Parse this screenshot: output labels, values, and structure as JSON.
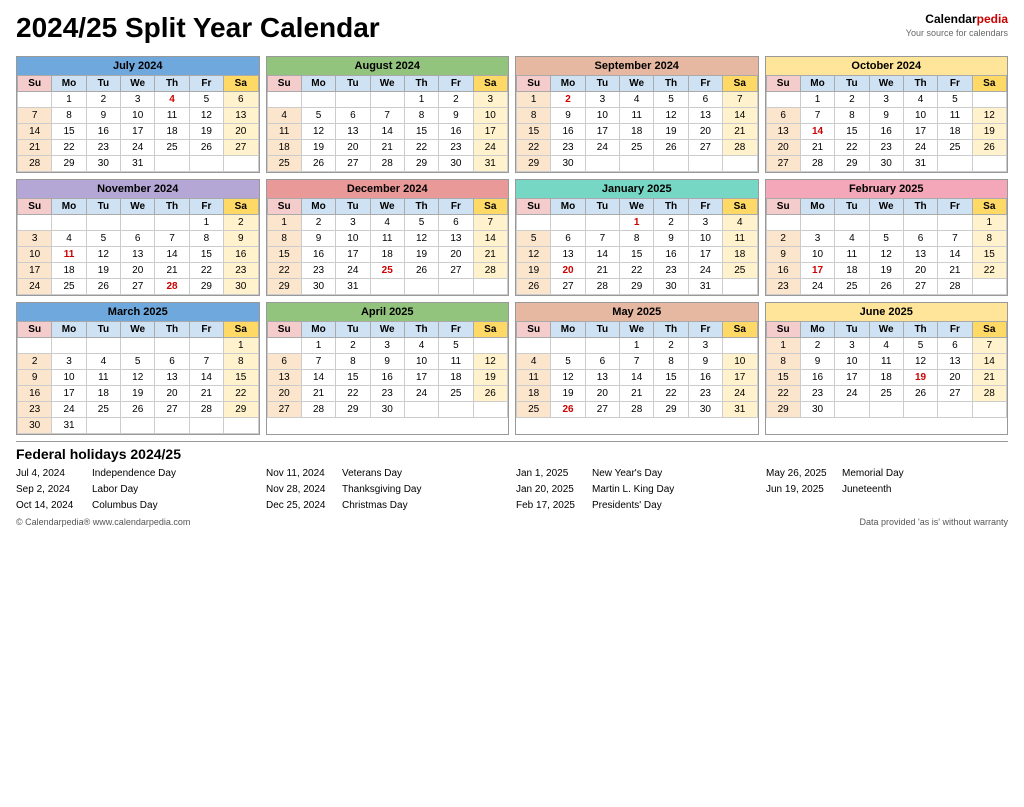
{
  "title": "2024/25 Split Year Calendar",
  "logo": {
    "calendar": "Calendar",
    "pedia": "pedia",
    "tagline": "Your source for calendars"
  },
  "months": [
    {
      "name": "July 2024",
      "headerClass": "blue",
      "days": [
        [
          "",
          "1",
          "2",
          "3",
          "4",
          "5",
          "6"
        ],
        [
          "7",
          "8",
          "9",
          "10",
          "11",
          "12",
          "13"
        ],
        [
          "14",
          "15",
          "16",
          "17",
          "18",
          "19",
          "20"
        ],
        [
          "21",
          "22",
          "23",
          "24",
          "25",
          "26",
          "27"
        ],
        [
          "28",
          "29",
          "30",
          "31",
          "",
          "",
          ""
        ]
      ],
      "holidays": [
        4
      ],
      "holidayType": "red"
    },
    {
      "name": "August 2024",
      "headerClass": "green",
      "days": [
        [
          "",
          "",
          "",
          "",
          "1",
          "2",
          "3"
        ],
        [
          "4",
          "5",
          "6",
          "7",
          "8",
          "9",
          "10"
        ],
        [
          "11",
          "12",
          "13",
          "14",
          "15",
          "16",
          "17"
        ],
        [
          "18",
          "19",
          "20",
          "21",
          "22",
          "23",
          "24"
        ],
        [
          "25",
          "26",
          "27",
          "28",
          "29",
          "30",
          "31"
        ]
      ],
      "holidays": [],
      "holidayType": ""
    },
    {
      "name": "September 2024",
      "headerClass": "orange",
      "days": [
        [
          "1",
          "2",
          "3",
          "4",
          "5",
          "6",
          "7"
        ],
        [
          "8",
          "9",
          "10",
          "11",
          "12",
          "13",
          "14"
        ],
        [
          "15",
          "16",
          "17",
          "18",
          "19",
          "20",
          "21"
        ],
        [
          "22",
          "23",
          "24",
          "25",
          "26",
          "27",
          "28"
        ],
        [
          "29",
          "30",
          "",
          "",
          "",
          "",
          ""
        ]
      ],
      "holidays": [
        2
      ],
      "holidayType": "red"
    },
    {
      "name": "October 2024",
      "headerClass": "yellow",
      "days": [
        [
          "",
          "1",
          "2",
          "3",
          "4",
          "5",
          ""
        ],
        [
          "6",
          "7",
          "8",
          "9",
          "10",
          "11",
          "12"
        ],
        [
          "13",
          "14",
          "15",
          "16",
          "17",
          "18",
          "19"
        ],
        [
          "20",
          "21",
          "22",
          "23",
          "24",
          "25",
          "26"
        ],
        [
          "27",
          "28",
          "29",
          "30",
          "31",
          "",
          ""
        ]
      ],
      "holidays": [
        14
      ],
      "holidayType": "red",
      "satBg": true
    },
    {
      "name": "November 2024",
      "headerClass": "purple",
      "days": [
        [
          "",
          "",
          "",
          "",
          "",
          "1",
          "2"
        ],
        [
          "3",
          "4",
          "5",
          "6",
          "7",
          "8",
          "9"
        ],
        [
          "10",
          "11",
          "12",
          "13",
          "14",
          "15",
          "16"
        ],
        [
          "17",
          "18",
          "19",
          "20",
          "21",
          "22",
          "23"
        ],
        [
          "24",
          "25",
          "26",
          "27",
          "28",
          "29",
          "30"
        ]
      ],
      "holidays": [
        11,
        28
      ],
      "holidayType": "red"
    },
    {
      "name": "December 2024",
      "headerClass": "red-h",
      "days": [
        [
          "1",
          "2",
          "3",
          "4",
          "5",
          "6",
          "7"
        ],
        [
          "8",
          "9",
          "10",
          "11",
          "12",
          "13",
          "14"
        ],
        [
          "15",
          "16",
          "17",
          "18",
          "19",
          "20",
          "21"
        ],
        [
          "22",
          "23",
          "24",
          "25",
          "26",
          "27",
          "28"
        ],
        [
          "29",
          "30",
          "31",
          "",
          "",
          "",
          ""
        ]
      ],
      "holidays": [
        25
      ],
      "holidayType": "red"
    },
    {
      "name": "January 2025",
      "headerClass": "teal",
      "days": [
        [
          "",
          "",
          "",
          "1",
          "2",
          "3",
          "4"
        ],
        [
          "5",
          "6",
          "7",
          "8",
          "9",
          "10",
          "11"
        ],
        [
          "12",
          "13",
          "14",
          "15",
          "16",
          "17",
          "18"
        ],
        [
          "19",
          "20",
          "21",
          "22",
          "23",
          "24",
          "25"
        ],
        [
          "26",
          "27",
          "28",
          "29",
          "30",
          "31",
          ""
        ]
      ],
      "holidays": [
        1,
        20
      ],
      "holidayType": "red"
    },
    {
      "name": "February 2025",
      "headerClass": "pink",
      "days": [
        [
          "",
          "",
          "",
          "",
          "",
          "",
          "1"
        ],
        [
          "2",
          "3",
          "4",
          "5",
          "6",
          "7",
          "8"
        ],
        [
          "9",
          "10",
          "11",
          "12",
          "13",
          "14",
          "15"
        ],
        [
          "16",
          "17",
          "18",
          "19",
          "20",
          "21",
          "22"
        ],
        [
          "23",
          "24",
          "25",
          "26",
          "27",
          "28",
          ""
        ]
      ],
      "holidays": [
        17
      ],
      "holidayType": "red"
    },
    {
      "name": "March 2025",
      "headerClass": "blue",
      "days": [
        [
          "",
          "",
          "",
          "",
          "",
          "",
          "1"
        ],
        [
          "2",
          "3",
          "4",
          "5",
          "6",
          "7",
          "8"
        ],
        [
          "9",
          "10",
          "11",
          "12",
          "13",
          "14",
          "15"
        ],
        [
          "16",
          "17",
          "18",
          "19",
          "20",
          "21",
          "22"
        ],
        [
          "23",
          "24",
          "25",
          "26",
          "27",
          "28",
          "29"
        ],
        [
          "30",
          "31",
          "",
          "",
          "",
          "",
          ""
        ]
      ],
      "holidays": [],
      "holidayType": ""
    },
    {
      "name": "April 2025",
      "headerClass": "green",
      "days": [
        [
          "",
          "1",
          "2",
          "3",
          "4",
          "5",
          ""
        ],
        [
          "6",
          "7",
          "8",
          "9",
          "10",
          "11",
          "12"
        ],
        [
          "13",
          "14",
          "15",
          "16",
          "17",
          "18",
          "19"
        ],
        [
          "20",
          "21",
          "22",
          "23",
          "24",
          "25",
          "26"
        ],
        [
          "27",
          "28",
          "29",
          "30",
          "",
          "",
          ""
        ]
      ],
      "holidays": [],
      "holidayType": ""
    },
    {
      "name": "May 2025",
      "headerClass": "orange",
      "days": [
        [
          "",
          "",
          "",
          "1",
          "2",
          "3",
          ""
        ],
        [
          "4",
          "5",
          "6",
          "7",
          "8",
          "9",
          "10"
        ],
        [
          "11",
          "12",
          "13",
          "14",
          "15",
          "16",
          "17"
        ],
        [
          "18",
          "19",
          "20",
          "21",
          "22",
          "23",
          "24"
        ],
        [
          "25",
          "26",
          "27",
          "28",
          "29",
          "30",
          "31"
        ]
      ],
      "holidays": [
        26
      ],
      "holidayType": "red"
    },
    {
      "name": "June 2025",
      "headerClass": "yellow",
      "days": [
        [
          "1",
          "2",
          "3",
          "4",
          "5",
          "6",
          "7"
        ],
        [
          "8",
          "9",
          "10",
          "11",
          "12",
          "13",
          "14"
        ],
        [
          "15",
          "16",
          "17",
          "18",
          "19",
          "20",
          "21"
        ],
        [
          "22",
          "23",
          "24",
          "25",
          "26",
          "27",
          "28"
        ],
        [
          "29",
          "30",
          "",
          "",
          "",
          "",
          ""
        ]
      ],
      "holidays": [
        19
      ],
      "holidayType": "red"
    }
  ],
  "weekdays": [
    "Su",
    "Mo",
    "Tu",
    "We",
    "Th",
    "Fr",
    "Sa"
  ],
  "holidays_title": "Federal holidays 2024/25",
  "holidays": [
    {
      "date": "Jul 4, 2024",
      "name": "Independence Day"
    },
    {
      "date": "Sep 2, 2024",
      "name": "Labor Day"
    },
    {
      "date": "Oct 14, 2024",
      "name": "Columbus Day"
    },
    {
      "date": "Nov 11, 2024",
      "name": "Veterans Day"
    },
    {
      "date": "Nov 28, 2024",
      "name": "Thanksgiving Day"
    },
    {
      "date": "Dec 25, 2024",
      "name": "Christmas Day"
    },
    {
      "date": "Jan 1, 2025",
      "name": "New Year's Day"
    },
    {
      "date": "Jan 20, 2025",
      "name": "Martin L. King Day"
    },
    {
      "date": "Feb 17, 2025",
      "name": "Presidents' Day"
    },
    {
      "date": "May 26, 2025",
      "name": "Memorial Day"
    },
    {
      "date": "Jun 19, 2025",
      "name": "Juneteenth"
    }
  ],
  "footer": {
    "left": "© Calendarpedia®   www.calendarpedia.com",
    "right": "Data provided 'as is' without warranty"
  }
}
